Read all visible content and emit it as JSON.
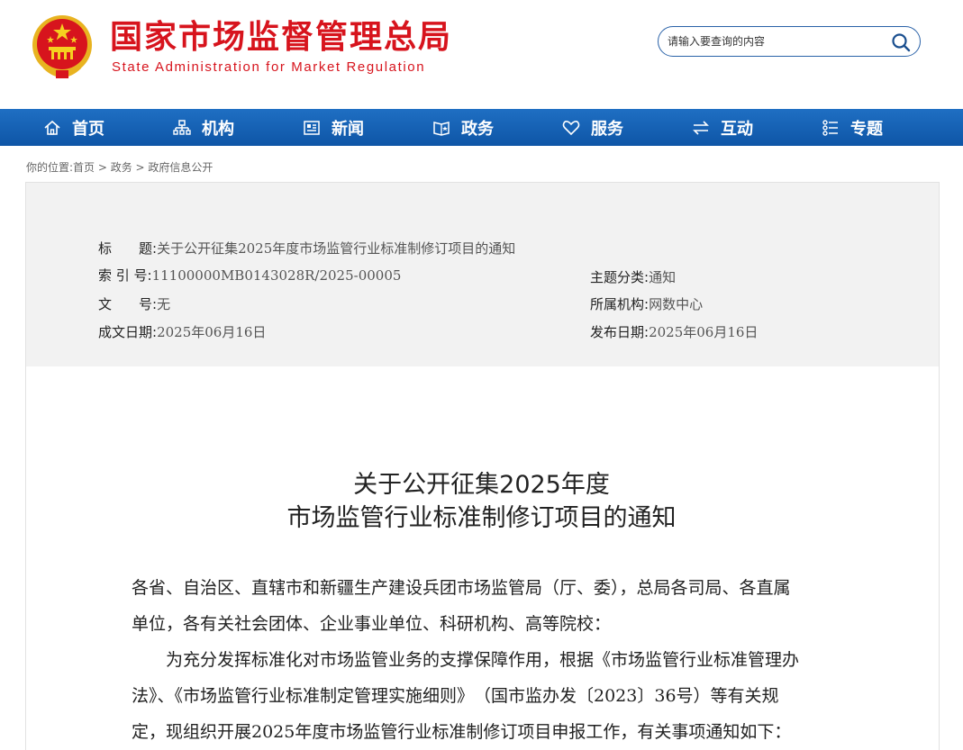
{
  "header": {
    "site_name_cn": "国家市场监督管理总局",
    "site_name_en": "State Administration for Market Regulation",
    "search_placeholder": "请输入要查询的内容"
  },
  "nav": [
    {
      "label": "首页",
      "icon": "home-icon"
    },
    {
      "label": "机构",
      "icon": "org-icon"
    },
    {
      "label": "新闻",
      "icon": "news-icon"
    },
    {
      "label": "政务",
      "icon": "government-icon"
    },
    {
      "label": "服务",
      "icon": "heart-icon"
    },
    {
      "label": "互动",
      "icon": "swap-icon"
    },
    {
      "label": "专题",
      "icon": "topics-icon"
    }
  ],
  "breadcrumb": "你的位置:首页 > 政务 > 政府信息公开",
  "info": {
    "title_label": "标　　题:",
    "title_value": "关于公开征集2025年度市场监管行业标准制修订项目的通知",
    "index_label": "索 引 号:",
    "index_value": "11100000MB0143028R/2025-00005",
    "category_label": "主题分类:",
    "category_value": "通知",
    "docno_label": "文　　号:",
    "docno_value": "无",
    "org_label": "所属机构:",
    "org_value": "网数中心",
    "created_label": "成文日期:",
    "created_value": "2025年06月16日",
    "published_label": "发布日期:",
    "published_value": "2025年06月16日"
  },
  "article": {
    "title_line1": "关于公开征集2025年度",
    "title_line2": "市场监管行业标准制修订项目的通知",
    "lines": [
      "各省、自治区、直辖市和新疆生产建设兵团市场监管局（厅、委），总局各司局、各直属",
      "单位，各有关社会团体、企业事业单位、科研机构、高等院校：",
      "　　为充分发挥标准化对市场监管业务的支撑保障作用，根据《市场监管行业标准管理办",
      "法》、《市场监管行业标准制定管理实施细则》　（国市监办发〔2023〕36号）等有关规",
      "定，现组织开展2025年度市场监管行业标准制修订项目申报工作，有关事项通知如下："
    ]
  }
}
